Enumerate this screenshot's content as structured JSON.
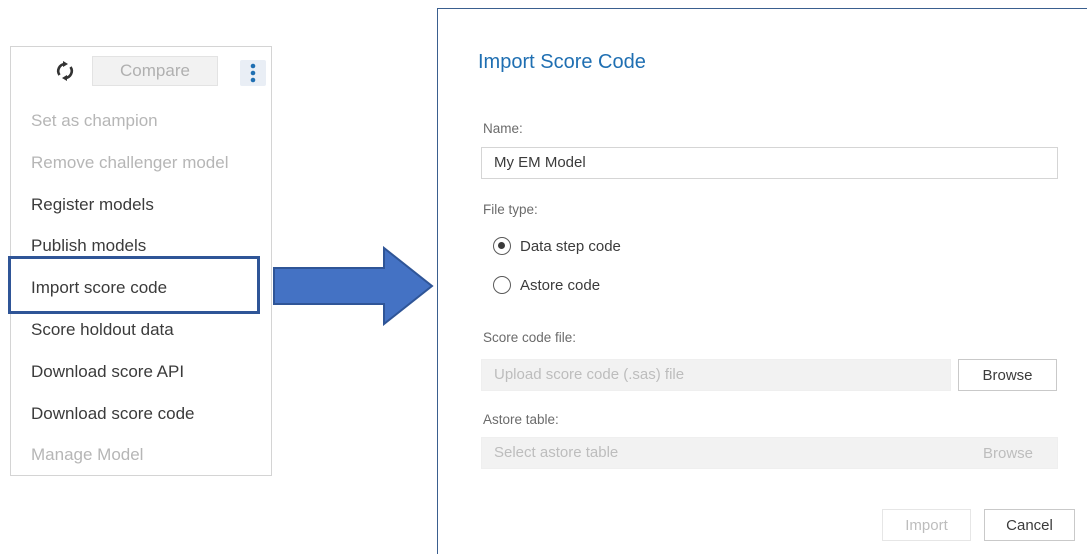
{
  "menu": {
    "toolbar": {
      "refresh_icon": "refresh-icon",
      "compare_label": "Compare",
      "more_icon": "kebab-menu-icon"
    },
    "items": [
      {
        "label": "Set as champion",
        "enabled": false
      },
      {
        "label": "Remove challenger model",
        "enabled": false
      },
      {
        "label": "Register models",
        "enabled": true
      },
      {
        "label": "Publish models",
        "enabled": true
      },
      {
        "label": "Import score code",
        "enabled": true,
        "highlighted": true
      },
      {
        "label": "Score holdout data",
        "enabled": true
      },
      {
        "label": "Download score API",
        "enabled": true
      },
      {
        "label": "Download score code",
        "enabled": true
      },
      {
        "label": "Manage Model",
        "enabled": false
      }
    ]
  },
  "colors": {
    "accent": "#1f6fb2",
    "highlight_border": "#2f5597",
    "arrow_fill": "#4472c4",
    "arrow_stroke": "#2f5597"
  },
  "dialog": {
    "title": "Import Score Code",
    "name_label": "Name:",
    "name_value": "My EM Model",
    "file_type_label": "File type:",
    "file_type_options": [
      {
        "label": "Data step code",
        "checked": true
      },
      {
        "label": "Astore code",
        "checked": false
      }
    ],
    "score_code_file_label": "Score code file:",
    "score_code_file_placeholder": "Upload score code (.sas) file",
    "browse_label": "Browse",
    "astore_table_label": "Astore table:",
    "astore_table_placeholder": "Select astore table",
    "astore_browse_label": "Browse",
    "import_label": "Import",
    "cancel_label": "Cancel"
  }
}
